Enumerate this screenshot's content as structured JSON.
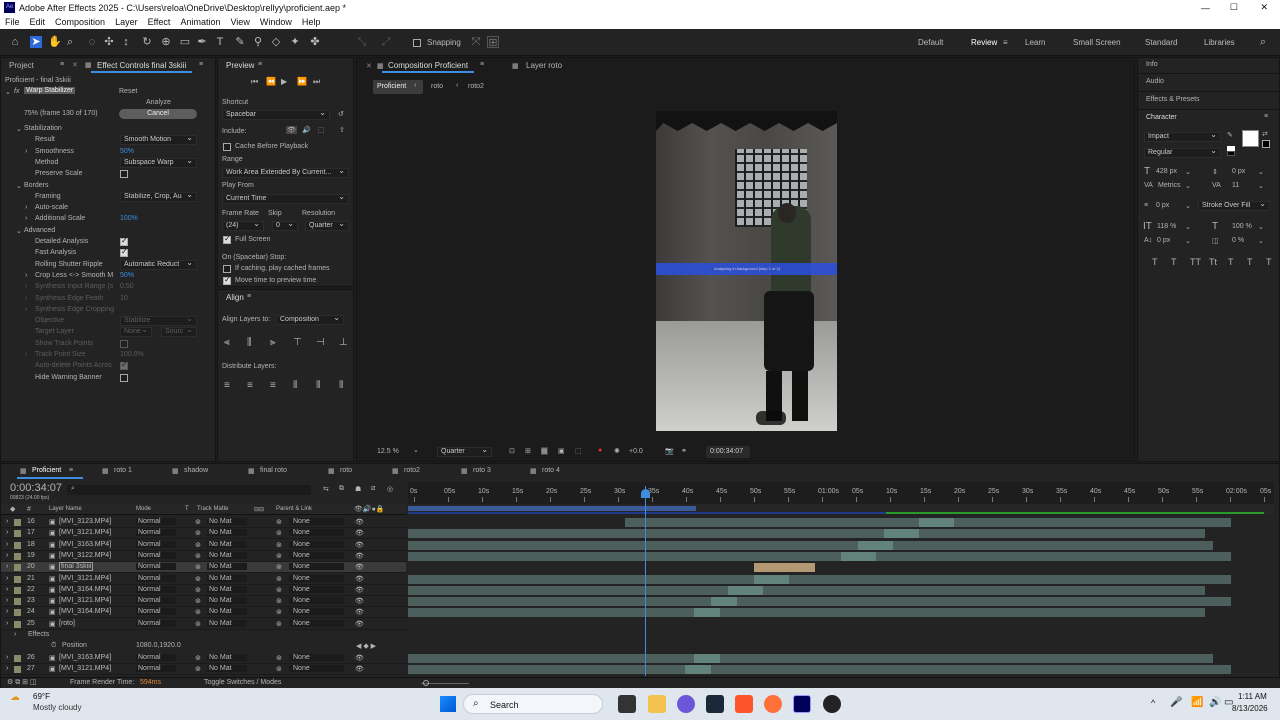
{
  "app": {
    "title": "Adobe After Effects 2025 - C:\\Users\\reloa\\OneDrive\\Desktop\\rellyy\\proficient.aep *"
  },
  "menu": [
    "File",
    "Edit",
    "Composition",
    "Layer",
    "Effect",
    "Animation",
    "View",
    "Window",
    "Help"
  ],
  "toolbar": {
    "snapping": "Snapping",
    "workspaces": [
      "Default",
      "Review",
      "Learn",
      "Small Screen",
      "Standard",
      "Libraries"
    ]
  },
  "project_panel": {
    "tab": "Project",
    "effect_tab": "Effect Controls final 3skiii",
    "layer_path": "Proficient - final 3skiii"
  },
  "effect": {
    "fx": "fx",
    "name": "Warp Stabilizer",
    "reset": "Reset",
    "analyze": "Analyze",
    "status": "75% (frame 130 of 170)",
    "cancel": "Cancel",
    "rows": [
      {
        "label": "Stabilization",
        "indent": 1,
        "tw": "v"
      },
      {
        "label": "Result",
        "indent": 2,
        "dd": "Smooth Motion"
      },
      {
        "label": "Smoothness",
        "indent": 2,
        "tw": ">",
        "val": "50%"
      },
      {
        "label": "Method",
        "indent": 2,
        "dd": "Subspace Warp"
      },
      {
        "label": "Preserve Scale",
        "indent": 2,
        "cb": false
      },
      {
        "label": "Borders",
        "indent": 1,
        "tw": "v"
      },
      {
        "label": "Framing",
        "indent": 2,
        "dd": "Stabilize, Crop, Au"
      },
      {
        "label": "Auto-scale",
        "indent": 2,
        "tw": ">"
      },
      {
        "label": "Additional Scale",
        "indent": 2,
        "tw": ">",
        "val": "100%"
      },
      {
        "label": "Advanced",
        "indent": 1,
        "tw": "v"
      },
      {
        "label": "Detailed Analysis",
        "indent": 2,
        "cb": true
      },
      {
        "label": "Fast Analysis",
        "indent": 2,
        "cb": true
      },
      {
        "label": "Rolling Shutter Ripple",
        "indent": 2,
        "dd": "Automatic Reduct"
      },
      {
        "label": "Crop Less <-> Smooth M",
        "indent": 2,
        "tw": ">",
        "val": "50%"
      },
      {
        "label": "Synthesis Input Range (s",
        "indent": 2,
        "tw": ">",
        "val": "0.50",
        "dim": true
      },
      {
        "label": "Synthesis Edge Feath",
        "indent": 2,
        "tw": ">",
        "val": "10",
        "dim": true
      },
      {
        "label": "Synthesis Edge Cropping",
        "indent": 2,
        "tw": ">",
        "dim": true
      },
      {
        "label": "Objective",
        "indent": 2,
        "dd": "Stabilize",
        "dim": true
      },
      {
        "label": "Target Layer",
        "indent": 2,
        "dd": "None",
        "dd2": "Sourc",
        "dim": true
      },
      {
        "label": "Show Track Points",
        "indent": 2,
        "cb": false,
        "dim": true
      },
      {
        "label": "Track Point Size",
        "indent": 2,
        "tw": ">",
        "val": "100.0%",
        "dim": true
      },
      {
        "label": "Auto-delete Points Acros",
        "indent": 2,
        "cb": true,
        "dim": true
      },
      {
        "label": "Hide Warning Banner",
        "indent": 2,
        "cb": false
      }
    ]
  },
  "preview": {
    "tab": "Preview",
    "shortcut_label": "Shortcut",
    "shortcut": "Spacebar",
    "include": "Include:",
    "cache": "Cache Before Playback",
    "range_label": "Range",
    "range": "Work Area Extended By Current...",
    "play_from_label": "Play From",
    "play_from": "Current Time",
    "frame_rate_label": "Frame Rate",
    "skip_label": "Skip",
    "resolution_label": "Resolution",
    "frame_rate": "(24)",
    "skip": "0",
    "resolution": "Quarter",
    "full_screen": "Full Screen",
    "stop_label": "On (Spacebar) Stop:",
    "if_caching": "If caching, play cached frames",
    "move_time": "Move time to preview time"
  },
  "align": {
    "tab": "Align",
    "align_to_label": "Align Layers to:",
    "align_to": "Composition",
    "distribute": "Distribute Layers:"
  },
  "comp": {
    "tab": "Composition Proficient",
    "layer_tab": "Layer roto",
    "crumbs": [
      "Proficient",
      "roto",
      "roto2"
    ],
    "overlay": "Analyzing in background (step 1 of 2)",
    "zoom": "12.5 %",
    "quality": "Quarter",
    "exposure": "+0.0",
    "timecode": "0:00:34:07"
  },
  "right": {
    "info": "Info",
    "audio": "Audio",
    "effects_presets": "Effects & Presets",
    "character": "Character",
    "font": "Impact",
    "style": "Regular",
    "size": "428 px",
    "leading": "0 px",
    "kerning": "Metrics",
    "tracking": "11",
    "stroke_w": "0 px",
    "stroke_type": "Stroke Over Fill",
    "vscale": "118 %",
    "hscale": "100 %",
    "baseline": "0 px",
    "tsume": "0 %",
    "tt": [
      "T",
      "T",
      "TT",
      "Tt",
      "T",
      "T",
      "T"
    ],
    "colors": {
      "fill": "#ffffff",
      "stroke": "#000000"
    }
  },
  "timeline": {
    "tabs": [
      "Proficient",
      "roto 1",
      "shadow",
      "final roto",
      "roto",
      "roto2",
      "roto 3",
      "roto 4"
    ],
    "timecode": "0:00:34:07",
    "fps": "00823 (24.00 fps)",
    "headers": [
      "#",
      "Layer Name",
      "Mode",
      "T",
      "Track Matte",
      "Parent & Link"
    ],
    "ruler": [
      "0s",
      "05s",
      "10s",
      "15s",
      "20s",
      "25s",
      "30s",
      "35s",
      "40s",
      "45s",
      "50s",
      "55s",
      "01:00s",
      "05s",
      "10s",
      "15s",
      "20s",
      "25s",
      "30s",
      "35s",
      "40s",
      "45s",
      "50s",
      "55s",
      "02:00s",
      "05s"
    ],
    "layers": [
      {
        "num": "16",
        "name": "[MVI_3123.MP4]",
        "mode": "Normal",
        "matte": "No Mat",
        "parent": "None",
        "bar": [
          0.25,
          0.95
        ],
        "hl": [
          0.59,
          0.63
        ]
      },
      {
        "num": "17",
        "name": "[MVI_3121.MP4]",
        "mode": "Normal",
        "matte": "No Mat",
        "parent": "None",
        "bar": [
          0.0,
          0.92
        ],
        "hl": [
          0.55,
          0.59
        ]
      },
      {
        "num": "18",
        "name": "[MVI_3163.MP4]",
        "mode": "Normal",
        "matte": "No Mat",
        "parent": "None",
        "bar": [
          0.0,
          0.93
        ],
        "hl": [
          0.52,
          0.56
        ]
      },
      {
        "num": "19",
        "name": "[MVI_3122.MP4]",
        "mode": "Normal",
        "matte": "No Mat",
        "parent": "None",
        "bar": [
          0.0,
          0.95
        ],
        "hl": [
          0.5,
          0.54
        ]
      },
      {
        "num": "20",
        "name": "final 3skiii",
        "mode": "Normal",
        "matte": "No Mat",
        "parent": "None",
        "bar": [
          0.4,
          0.47
        ],
        "sel": true
      },
      {
        "num": "21",
        "name": "[MVI_3121.MP4]",
        "mode": "Normal",
        "matte": "No Mat",
        "parent": "None",
        "bar": [
          0.0,
          0.95
        ],
        "hl": [
          0.4,
          0.44
        ]
      },
      {
        "num": "22",
        "name": "[MVI_3164.MP4]",
        "mode": "Normal",
        "matte": "No Mat",
        "parent": "None",
        "bar": [
          0.0,
          0.92
        ],
        "hl": [
          0.37,
          0.41
        ]
      },
      {
        "num": "23",
        "name": "[MVI_3121.MP4]",
        "mode": "Normal",
        "matte": "No Mat",
        "parent": "None",
        "bar": [
          0.0,
          0.95
        ],
        "hl": [
          0.35,
          0.38
        ]
      },
      {
        "num": "24",
        "name": "[MVI_3164.MP4]",
        "mode": "Normal",
        "matte": "No Mat",
        "parent": "None",
        "bar": [
          0.0,
          0.92
        ],
        "hl": [
          0.33,
          0.36
        ]
      },
      {
        "num": "25",
        "name": "[roto]",
        "mode": "Normal",
        "matte": "No Mat",
        "parent": "None",
        "bar": [
          0.0,
          0.0
        ]
      }
    ],
    "effects_label": "Effects",
    "position_label": "Position",
    "position_value": "1080.0,1920.0",
    "layers2": [
      {
        "num": "26",
        "name": "[MVI_3163.MP4]",
        "mode": "Normal",
        "matte": "No Mat",
        "parent": "None",
        "bar": [
          0.0,
          0.93
        ],
        "hl": [
          0.33,
          0.36
        ]
      },
      {
        "num": "27",
        "name": "[MVI_3121.MP4]",
        "mode": "Normal",
        "matte": "No Mat",
        "parent": "None",
        "bar": [
          0.0,
          0.95
        ],
        "hl": [
          0.32,
          0.35
        ]
      }
    ],
    "frame_render_label": "Frame Render Time:",
    "frame_render": "594ms",
    "toggle": "Toggle Switches / Modes"
  },
  "taskbar": {
    "temp": "69°F",
    "weather": "Mostly cloudy",
    "search": "Search",
    "time": "1:11 AM",
    "date": "8/13/2026"
  }
}
